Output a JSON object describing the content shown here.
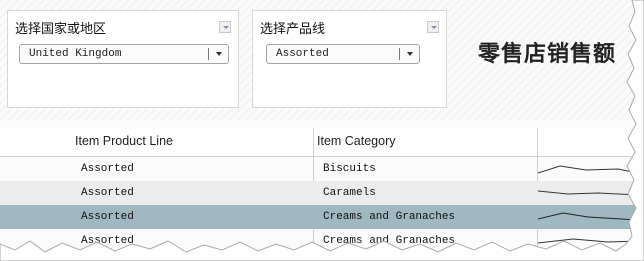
{
  "filters": {
    "country": {
      "title": "选择国家或地区",
      "value": "United Kingdom"
    },
    "product_line": {
      "title": "选择产品线",
      "value": "Assorted"
    }
  },
  "headline": "零售店销售额",
  "table": {
    "columns": [
      "Item Product Line",
      "Item Category"
    ],
    "rows": [
      {
        "product_line": "Assorted",
        "category": "Biscuits"
      },
      {
        "product_line": "Assorted",
        "category": "Caramels"
      },
      {
        "product_line": "Assorted",
        "category": "Creams and Granaches"
      },
      {
        "product_line": "Assorted",
        "category": "Creams and Granaches"
      }
    ],
    "selected_row": 2
  },
  "colors": {
    "selected_row": "#9fb8c2",
    "alt_row": "#ececec"
  }
}
